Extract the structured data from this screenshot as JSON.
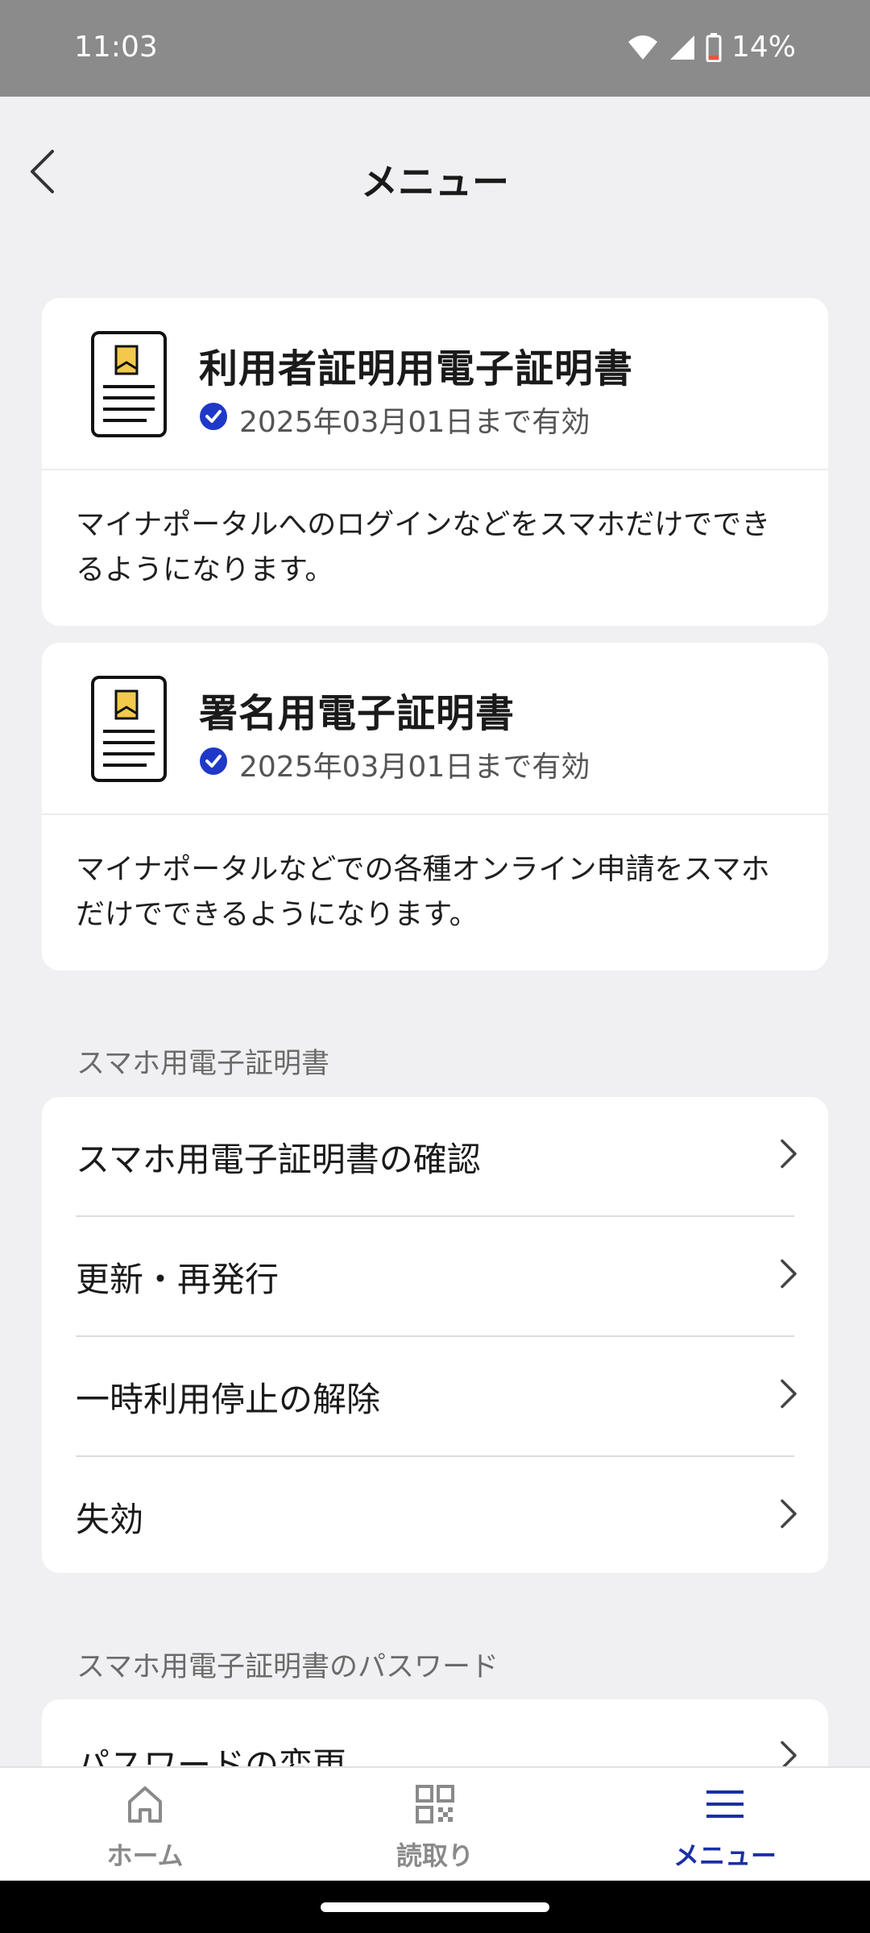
{
  "status": {
    "time": "11:03",
    "battery": "14%"
  },
  "header": {
    "title": "メニュー"
  },
  "certificates": [
    {
      "title": "利用者証明用電子証明書",
      "validity": "2025年03月01日まで有効",
      "description": "マイナポータルへのログインなどをスマホだけでできるようになります。"
    },
    {
      "title": "署名用電子証明書",
      "validity": "2025年03月01日まで有効",
      "description": "マイナポータルなどでの各種オンライン申請をスマホだけでできるようになります。"
    }
  ],
  "sections": [
    {
      "label": "スマホ用電子証明書",
      "items": [
        "スマホ用電子証明書の確認",
        "更新・再発行",
        "一時利用停止の解除",
        "失効"
      ]
    },
    {
      "label": "スマホ用電子証明書のパスワード",
      "items": [
        "パスワードの変更"
      ]
    }
  ],
  "nav": {
    "home": "ホーム",
    "scan": "読取り",
    "menu": "メニュー"
  },
  "colors": {
    "accent": "#1b2fa6",
    "check": "#1f38c8",
    "bookmark": "#f2c94c"
  },
  "icons": [
    "back-chevron-icon",
    "certificate-icon",
    "check-circle-icon",
    "chevron-right-icon",
    "home-icon",
    "qr-code-icon",
    "menu-icon"
  ]
}
